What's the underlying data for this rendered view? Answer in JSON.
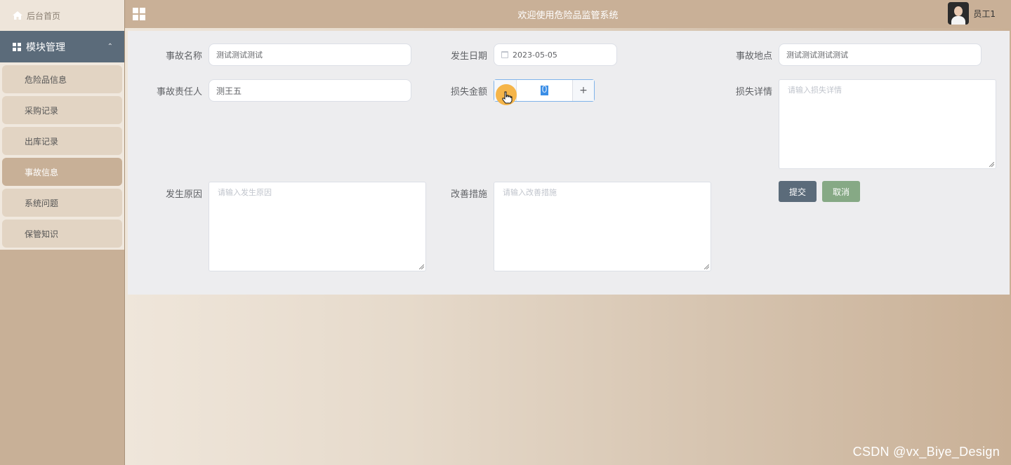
{
  "sidebar": {
    "home_label": "后台首页",
    "module_label": "模块管理",
    "items": [
      {
        "label": "危险品信息",
        "active": false
      },
      {
        "label": "采购记录",
        "active": false
      },
      {
        "label": "出库记录",
        "active": false
      },
      {
        "label": "事故信息",
        "active": true
      },
      {
        "label": "系统问题",
        "active": false
      },
      {
        "label": "保管知识",
        "active": false
      }
    ]
  },
  "header": {
    "title": "欢迎使用危险品监管系统",
    "user_name": "员工1"
  },
  "form": {
    "accident_name": {
      "label": "事故名称",
      "value": "测试测试测试"
    },
    "occur_date": {
      "label": "发生日期",
      "value": "2023-05-05"
    },
    "accident_location": {
      "label": "事故地点",
      "value": "测试测试测试测试"
    },
    "responsible_person": {
      "label": "事故责任人",
      "value": "测王五"
    },
    "loss_amount": {
      "label": "损失金额",
      "value": "0",
      "minus": "−",
      "plus": "+"
    },
    "loss_details": {
      "label": "损失详情",
      "placeholder": "请输入损失详情"
    },
    "cause": {
      "label": "发生原因",
      "placeholder": "请输入发生原因"
    },
    "improvement": {
      "label": "改善措施",
      "placeholder": "请输入改善措施"
    },
    "submit_label": "提交",
    "cancel_label": "取消"
  },
  "watermark": "CSDN @vx_Biye_Design",
  "colors": {
    "sidebar_module_bg": "#5b6b7a",
    "active_item_bg": "#c8b097",
    "submit_bg": "#5b6b7a",
    "cancel_bg": "#86a985",
    "header_bg": "#c9b097"
  }
}
